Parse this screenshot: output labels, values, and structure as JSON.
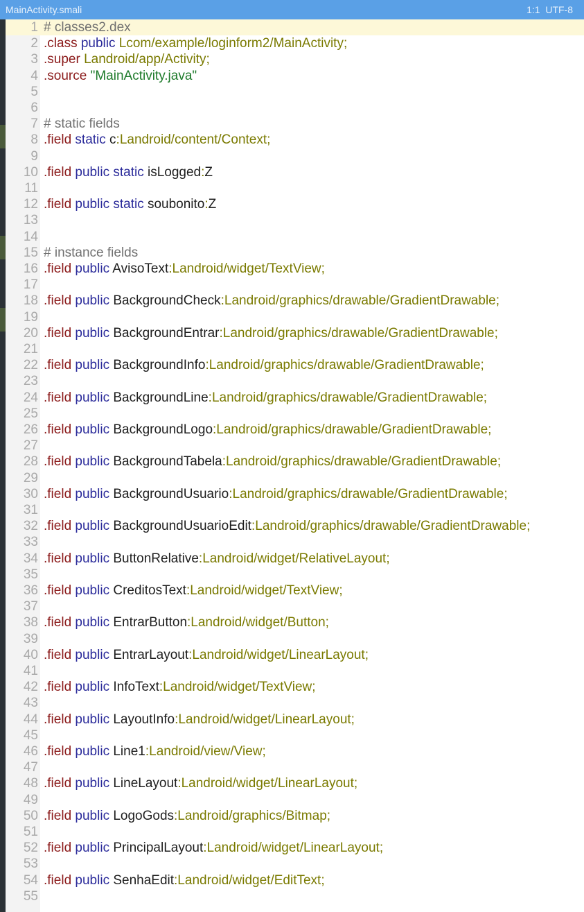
{
  "titlebar": {
    "filename": "MainActivity.smali",
    "cursor": "1:1",
    "encoding": "UTF-8"
  },
  "colors": {
    "titlebar_bg": "#5aa0e6",
    "directive": "#8b1a1a",
    "keyword": "#2a2a9a",
    "type": "#7a7a00",
    "string": "#1d7a2a",
    "comment": "#707070",
    "line_number": "#a9a9a9",
    "current_line_bg": "#fdf8d8"
  },
  "lines": [
    {
      "n": "1",
      "t": [
        {
          "c": "comment",
          "s": "# classes2.dex"
        }
      ]
    },
    {
      "n": "2",
      "t": [
        {
          "c": "directive",
          "s": ".class "
        },
        {
          "c": "keyword",
          "s": "public "
        },
        {
          "c": "type",
          "s": "Lcom/example/loginform2/MainActivity;"
        }
      ]
    },
    {
      "n": "3",
      "t": [
        {
          "c": "directive",
          "s": ".super "
        },
        {
          "c": "type",
          "s": "Landroid/app/Activity;"
        }
      ]
    },
    {
      "n": "4",
      "t": [
        {
          "c": "directive",
          "s": ".source "
        },
        {
          "c": "string",
          "s": "\"MainActivity.java\""
        }
      ]
    },
    {
      "n": "5",
      "t": []
    },
    {
      "n": "6",
      "t": []
    },
    {
      "n": "7",
      "t": [
        {
          "c": "comment",
          "s": "# static fields"
        }
      ]
    },
    {
      "n": "8",
      "t": [
        {
          "c": "directive",
          "s": ".field "
        },
        {
          "c": "keyword",
          "s": "static "
        },
        {
          "c": "name",
          "s": "c"
        },
        {
          "c": "type",
          "s": ":Landroid/content/Context;"
        }
      ]
    },
    {
      "n": "9",
      "t": []
    },
    {
      "n": "10",
      "t": [
        {
          "c": "directive",
          "s": ".field "
        },
        {
          "c": "keyword",
          "s": "public static "
        },
        {
          "c": "name",
          "s": "isLogged"
        },
        {
          "c": "type",
          "s": ":"
        },
        {
          "c": "name",
          "s": "Z"
        }
      ]
    },
    {
      "n": "11",
      "t": []
    },
    {
      "n": "12",
      "t": [
        {
          "c": "directive",
          "s": ".field "
        },
        {
          "c": "keyword",
          "s": "public static "
        },
        {
          "c": "name",
          "s": "soubonito"
        },
        {
          "c": "type",
          "s": ":"
        },
        {
          "c": "name",
          "s": "Z"
        }
      ]
    },
    {
      "n": "13",
      "t": []
    },
    {
      "n": "14",
      "t": []
    },
    {
      "n": "15",
      "t": [
        {
          "c": "comment",
          "s": "# instance fields"
        }
      ]
    },
    {
      "n": "16",
      "t": [
        {
          "c": "directive",
          "s": ".field "
        },
        {
          "c": "keyword",
          "s": "public "
        },
        {
          "c": "name",
          "s": "AvisoText"
        },
        {
          "c": "type",
          "s": ":Landroid/widget/TextView;"
        }
      ]
    },
    {
      "n": "17",
      "t": []
    },
    {
      "n": "18",
      "t": [
        {
          "c": "directive",
          "s": ".field "
        },
        {
          "c": "keyword",
          "s": "public "
        },
        {
          "c": "name",
          "s": "BackgroundCheck"
        },
        {
          "c": "type",
          "s": ":Landroid/graphics/drawable/GradientDrawable;"
        }
      ]
    },
    {
      "n": "19",
      "t": []
    },
    {
      "n": "20",
      "t": [
        {
          "c": "directive",
          "s": ".field "
        },
        {
          "c": "keyword",
          "s": "public "
        },
        {
          "c": "name",
          "s": "BackgroundEntrar"
        },
        {
          "c": "type",
          "s": ":Landroid/graphics/drawable/GradientDrawable;"
        }
      ]
    },
    {
      "n": "21",
      "t": []
    },
    {
      "n": "22",
      "t": [
        {
          "c": "directive",
          "s": ".field "
        },
        {
          "c": "keyword",
          "s": "public "
        },
        {
          "c": "name",
          "s": "BackgroundInfo"
        },
        {
          "c": "type",
          "s": ":Landroid/graphics/drawable/GradientDrawable;"
        }
      ]
    },
    {
      "n": "23",
      "t": []
    },
    {
      "n": "24",
      "t": [
        {
          "c": "directive",
          "s": ".field "
        },
        {
          "c": "keyword",
          "s": "public "
        },
        {
          "c": "name",
          "s": "BackgroundLine"
        },
        {
          "c": "type",
          "s": ":Landroid/graphics/drawable/GradientDrawable;"
        }
      ]
    },
    {
      "n": "25",
      "t": []
    },
    {
      "n": "26",
      "t": [
        {
          "c": "directive",
          "s": ".field "
        },
        {
          "c": "keyword",
          "s": "public "
        },
        {
          "c": "name",
          "s": "BackgroundLogo"
        },
        {
          "c": "type",
          "s": ":Landroid/graphics/drawable/GradientDrawable;"
        }
      ]
    },
    {
      "n": "27",
      "t": []
    },
    {
      "n": "28",
      "t": [
        {
          "c": "directive",
          "s": ".field "
        },
        {
          "c": "keyword",
          "s": "public "
        },
        {
          "c": "name",
          "s": "BackgroundTabela"
        },
        {
          "c": "type",
          "s": ":Landroid/graphics/drawable/GradientDrawable;"
        }
      ]
    },
    {
      "n": "29",
      "t": []
    },
    {
      "n": "30",
      "t": [
        {
          "c": "directive",
          "s": ".field "
        },
        {
          "c": "keyword",
          "s": "public "
        },
        {
          "c": "name",
          "s": "BackgroundUsuario"
        },
        {
          "c": "type",
          "s": ":Landroid/graphics/drawable/GradientDrawable;"
        }
      ]
    },
    {
      "n": "31",
      "t": []
    },
    {
      "n": "32",
      "t": [
        {
          "c": "directive",
          "s": ".field "
        },
        {
          "c": "keyword",
          "s": "public "
        },
        {
          "c": "name",
          "s": "BackgroundUsuarioEdit"
        },
        {
          "c": "type",
          "s": ":Landroid/graphics/drawable/GradientDrawable;"
        }
      ]
    },
    {
      "n": "33",
      "t": []
    },
    {
      "n": "34",
      "t": [
        {
          "c": "directive",
          "s": ".field "
        },
        {
          "c": "keyword",
          "s": "public "
        },
        {
          "c": "name",
          "s": "ButtonRelative"
        },
        {
          "c": "type",
          "s": ":Landroid/widget/RelativeLayout;"
        }
      ]
    },
    {
      "n": "35",
      "t": []
    },
    {
      "n": "36",
      "t": [
        {
          "c": "directive",
          "s": ".field "
        },
        {
          "c": "keyword",
          "s": "public "
        },
        {
          "c": "name",
          "s": "CreditosText"
        },
        {
          "c": "type",
          "s": ":Landroid/widget/TextView;"
        }
      ]
    },
    {
      "n": "37",
      "t": []
    },
    {
      "n": "38",
      "t": [
        {
          "c": "directive",
          "s": ".field "
        },
        {
          "c": "keyword",
          "s": "public "
        },
        {
          "c": "name",
          "s": "EntrarButton"
        },
        {
          "c": "type",
          "s": ":Landroid/widget/Button;"
        }
      ]
    },
    {
      "n": "39",
      "t": []
    },
    {
      "n": "40",
      "t": [
        {
          "c": "directive",
          "s": ".field "
        },
        {
          "c": "keyword",
          "s": "public "
        },
        {
          "c": "name",
          "s": "EntrarLayout"
        },
        {
          "c": "type",
          "s": ":Landroid/widget/LinearLayout;"
        }
      ]
    },
    {
      "n": "41",
      "t": []
    },
    {
      "n": "42",
      "t": [
        {
          "c": "directive",
          "s": ".field "
        },
        {
          "c": "keyword",
          "s": "public "
        },
        {
          "c": "name",
          "s": "InfoText"
        },
        {
          "c": "type",
          "s": ":Landroid/widget/TextView;"
        }
      ]
    },
    {
      "n": "43",
      "t": []
    },
    {
      "n": "44",
      "t": [
        {
          "c": "directive",
          "s": ".field "
        },
        {
          "c": "keyword",
          "s": "public "
        },
        {
          "c": "name",
          "s": "LayoutInfo"
        },
        {
          "c": "type",
          "s": ":Landroid/widget/LinearLayout;"
        }
      ]
    },
    {
      "n": "45",
      "t": []
    },
    {
      "n": "46",
      "t": [
        {
          "c": "directive",
          "s": ".field "
        },
        {
          "c": "keyword",
          "s": "public "
        },
        {
          "c": "name",
          "s": "Line1"
        },
        {
          "c": "type",
          "s": ":Landroid/view/View;"
        }
      ]
    },
    {
      "n": "47",
      "t": []
    },
    {
      "n": "48",
      "t": [
        {
          "c": "directive",
          "s": ".field "
        },
        {
          "c": "keyword",
          "s": "public "
        },
        {
          "c": "name",
          "s": "LineLayout"
        },
        {
          "c": "type",
          "s": ":Landroid/widget/LinearLayout;"
        }
      ]
    },
    {
      "n": "49",
      "t": []
    },
    {
      "n": "50",
      "t": [
        {
          "c": "directive",
          "s": ".field "
        },
        {
          "c": "keyword",
          "s": "public "
        },
        {
          "c": "name",
          "s": "LogoGods"
        },
        {
          "c": "type",
          "s": ":Landroid/graphics/Bitmap;"
        }
      ]
    },
    {
      "n": "51",
      "t": []
    },
    {
      "n": "52",
      "t": [
        {
          "c": "directive",
          "s": ".field "
        },
        {
          "c": "keyword",
          "s": "public "
        },
        {
          "c": "name",
          "s": "PrincipalLayout"
        },
        {
          "c": "type",
          "s": ":Landroid/widget/LinearLayout;"
        }
      ]
    },
    {
      "n": "53",
      "t": []
    },
    {
      "n": "54",
      "t": [
        {
          "c": "directive",
          "s": ".field "
        },
        {
          "c": "keyword",
          "s": "public "
        },
        {
          "c": "name",
          "s": "SenhaEdit"
        },
        {
          "c": "type",
          "s": ":Landroid/widget/EditText;"
        }
      ]
    },
    {
      "n": "55",
      "t": []
    }
  ]
}
